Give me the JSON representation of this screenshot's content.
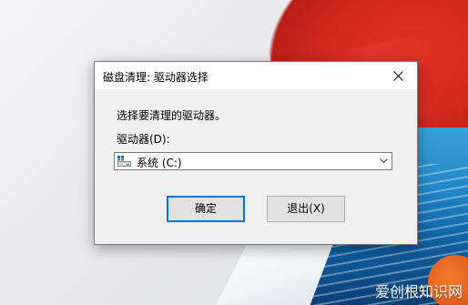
{
  "dialog": {
    "title": "磁盘清理: 驱动器选择",
    "prompt": "选择要清理的驱动器。",
    "drive_label": "驱动器(D):",
    "drive_select": {
      "selected": "系统 (C:)",
      "icon": "drive-icon"
    },
    "buttons": {
      "ok": "确定",
      "exit": "退出(X)"
    },
    "close_icon": "close-icon"
  },
  "watermark": "爱创根知识网",
  "colors": {
    "focus_border": "#0078d7",
    "dialog_bg": "#f0f0f0"
  }
}
